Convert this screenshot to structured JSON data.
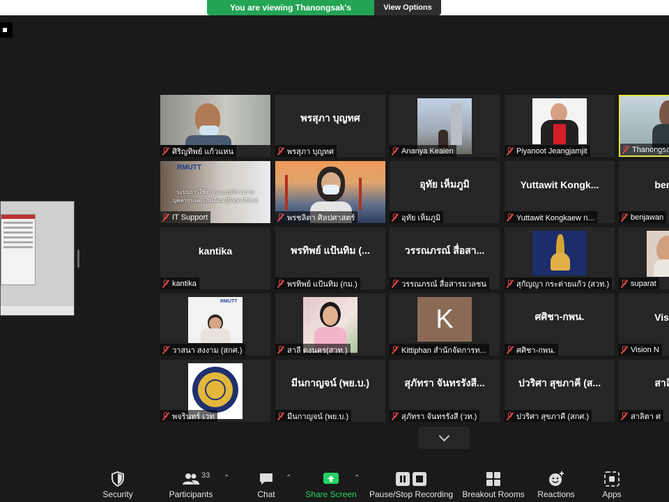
{
  "banner": {
    "text": "You are viewing Thanongsak's screen",
    "view_options": "View Options"
  },
  "participants": [
    {
      "big": "",
      "name": "ศิริญทิพย์ แก้วแหน",
      "photo": "office-woman"
    },
    {
      "big": "พรสุภา บุญทศ",
      "name": "พรสุภา บุญทศ",
      "photo": ""
    },
    {
      "big": "",
      "name": "Ananya Keaien",
      "photo": "city"
    },
    {
      "big": "",
      "name": "Piyanoot Jeangjamjit",
      "photo": "woman-red"
    },
    {
      "big": "",
      "name": "Thanongsak",
      "photo": "man",
      "active": true
    },
    {
      "big": "",
      "name": "IT Support",
      "photo": "slide",
      "slide_line1": "ระบบการใช้งานระบบบริหารงาน",
      "slide_line2": "บุคลากรและเงินเดือน (Back Office)",
      "slide_logo": "RMUTT"
    },
    {
      "big": "",
      "name": "พรชลิตา ศิลปศาสตร์",
      "photo": "bridge"
    },
    {
      "big": "อุทัย เห็มภูมิ",
      "name": "อุทัย เห็มภูมิ",
      "photo": ""
    },
    {
      "big": "Yuttawit  Kongk...",
      "name": "Yuttawit Kongkaew ก...",
      "photo": ""
    },
    {
      "big": "benjawa",
      "name": "benjawan",
      "photo": ""
    },
    {
      "big": "kantika",
      "name": "kantika",
      "photo": ""
    },
    {
      "big": "พรทิพย์ แป้นทิม (...",
      "name": "พรทิพย์ แป้นทิม (กม.)",
      "photo": ""
    },
    {
      "big": "วรรณภรณ์ สื่อสา...",
      "name": "วรรณภรณ์ สื่อสารมวลชน",
      "photo": ""
    },
    {
      "big": "",
      "name": "สุกัญญา กระต่ายแก้ว (สวท.)",
      "photo": "trophy"
    },
    {
      "big": "",
      "name": "suparat",
      "photo": "woman-glasses"
    },
    {
      "big": "",
      "name": "วาสนา สงงาม (สกศ.)",
      "photo": "woman-slide",
      "slide_logo": "RMUTT"
    },
    {
      "big": "",
      "name": "สาลี ดงนคร(สวท.)",
      "photo": "woman-flowers"
    },
    {
      "big": "",
      "name": "Kittiphan สำนักจัดการท...",
      "photo": "initial",
      "initial": "K"
    },
    {
      "big": "ศศิชา-กพน.",
      "name": "ศศิชา-กพน.",
      "photo": ""
    },
    {
      "big": "Vision N",
      "name": "Vision N",
      "photo": ""
    },
    {
      "big": "",
      "name": "พจรินทร์ เวท",
      "photo": "logo"
    },
    {
      "big": "มีนกาญจน์ (พย.บ.)",
      "name": "มีนกาญจน์ (พย.บ.)",
      "photo": ""
    },
    {
      "big": "สุภัทรา จันทรรังสี...",
      "name": "สุภัทรา จันทรรังสี (วท.)",
      "photo": ""
    },
    {
      "big": "ปวริศา สุขภาคี (ส...",
      "name": "ปวริศา สุขภาคี (สกศ.)",
      "photo": ""
    },
    {
      "big": "สาลิตา  ค",
      "name": "สาลิตา  ศ",
      "photo": ""
    }
  ],
  "toolbar": {
    "security": "Security",
    "participants": "Participants",
    "participants_count": "33",
    "chat": "Chat",
    "share": "Share Screen",
    "record": "Pause/Stop Recording",
    "breakout": "Breakout Rooms",
    "reactions": "Reactions",
    "apps": "Apps"
  },
  "colors": {
    "banner_green": "#23a455",
    "active_border": "#e9e43c",
    "share_green": "#23d366",
    "muted_red": "#e04848"
  }
}
